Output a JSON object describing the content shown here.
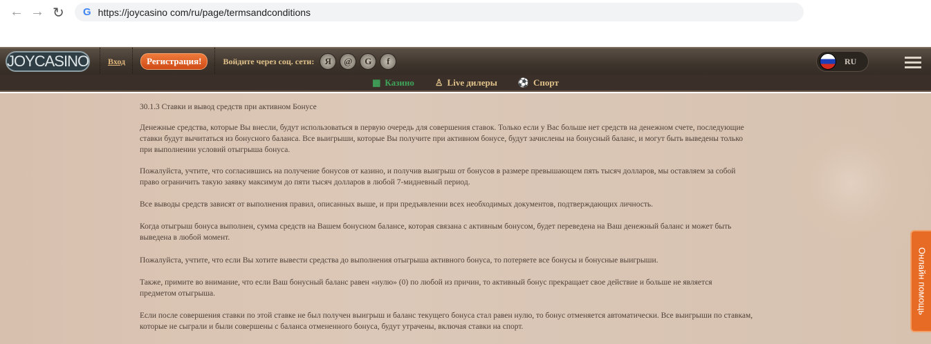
{
  "browser": {
    "url": "https://joycasino com/ru/page/termsandconditions"
  },
  "header": {
    "logo": "JOYCASINO",
    "login": "Вход",
    "register": "Регистрация!",
    "social_label": "Войдите через соц. сети:",
    "social": [
      "Я",
      "@",
      "G",
      "f"
    ],
    "language": "RU"
  },
  "subnav": [
    {
      "label": "Казино",
      "color": "#3fa35a"
    },
    {
      "label": "Live дилеры",
      "color": "#e0c28a"
    },
    {
      "label": "Спорт",
      "color": "#e0c28a"
    }
  ],
  "content": {
    "heading": "30.1.3 Ставки и вывод средств при активном Бонусе",
    "paragraphs": [
      [
        "Денежные средства, которые Вы внесли, будут использоваться в первую очередь для совершения ставок. Только если у Вас больше нет средств на денежном счете, последующие",
        "ставки будут вычитаться из бонусного баланса. Все выигрыши, которые Вы получите при активном бонусе, будут зачислены на бонусный баланс, и могут быть выведены только",
        "при выполнении условий отыгрыша бонуса."
      ],
      [
        "Пожалуйста, учтите, что согласившись на получение бонусов от казино, и получив выигрыш от бонусов в размере превышающем пять тысяч долларов, мы оставляем за собой",
        "право ограничить такую заявку максимум до пяти тысяч долларов в любой 7-мидневный период."
      ],
      [
        "Все выводы средств зависят от выполнения правил, описанных выше, и при предъявлении всех необходимых документов, подтверждающих личность."
      ],
      [
        "Когда отыгрыш бонуса выполнен, сумма средств на Вашем бонусном балансе, которая связана с активным бонусом, будет переведена на Ваш денежный баланс и может быть",
        "выведена в любой момент."
      ],
      [
        "Пожалуйста, учтите, что если Вы хотите вывести средства до выполнения отыгрыша активного бонуса, то потеряете все бонусы и бонусные выигрыши."
      ],
      [
        "Также, примите во внимание, что если Ваш бонусный баланс равен «нулю» (0) по любой из причин, то активный бонус прекращает свое действие и больше не является",
        "предметом отыгрыша."
      ],
      [
        "Если после совершения ставки по этой ставке не был получен выигрыш и баланс текущего бонуса стал равен нулю, то бонус отменяется автоматически. Все выигрыши по ставкам,",
        "которые не сыграли и были совершены с баланса отмененного бонуса, будут утрачены, включая ставки на спорт."
      ]
    ]
  },
  "help": "Онлайн помощь"
}
